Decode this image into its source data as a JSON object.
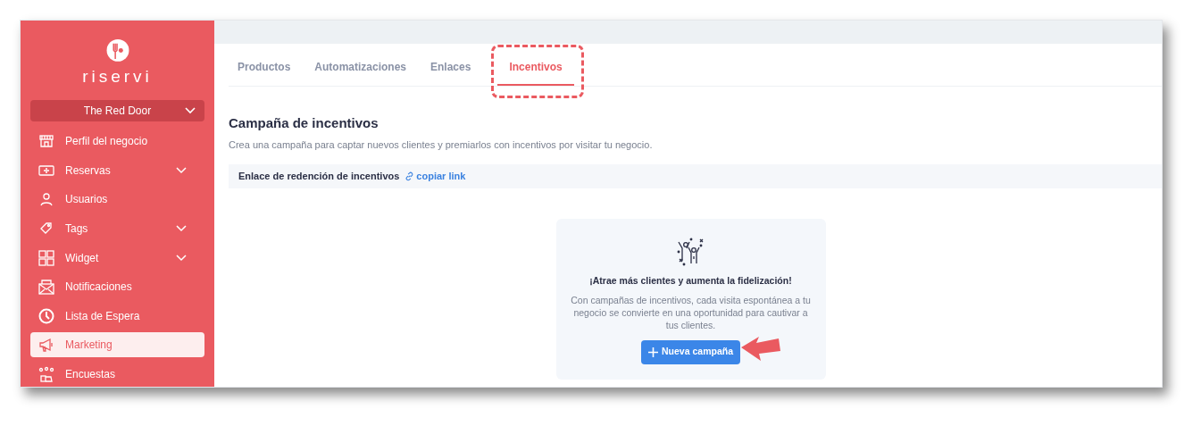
{
  "sidebar": {
    "brand": "riservi",
    "venue": "The Red Door",
    "items": [
      {
        "label": "Perfil del negocio",
        "expandable": false,
        "selected": false
      },
      {
        "label": "Reservas",
        "expandable": true,
        "selected": false
      },
      {
        "label": "Usuarios",
        "expandable": false,
        "selected": false
      },
      {
        "label": "Tags",
        "expandable": true,
        "selected": false
      },
      {
        "label": "Widget",
        "expandable": true,
        "selected": false
      },
      {
        "label": "Notificaciones",
        "expandable": false,
        "selected": false
      },
      {
        "label": "Lista de Espera",
        "expandable": false,
        "selected": false
      },
      {
        "label": "Marketing",
        "expandable": false,
        "selected": true
      },
      {
        "label": "Encuestas",
        "expandable": false,
        "selected": false
      }
    ]
  },
  "tabs": [
    {
      "label": "Productos",
      "selected": false
    },
    {
      "label": "Automatizaciones",
      "selected": false
    },
    {
      "label": "Enlaces",
      "selected": false
    },
    {
      "label": "Incentivos",
      "selected": true
    }
  ],
  "page": {
    "title": "Campaña de incentivos",
    "subtitle": "Crea una campaña para captar nuevos clientes y premiarlos con incentivos por visitar tu negocio.",
    "link_bar": {
      "label": "Enlace de redención de incentivos",
      "link": "copiar link"
    },
    "empty_state": {
      "heading": "¡Atrae más clientes y aumenta la fidelización!",
      "text": "Con campañas de incentivos, cada visita espontánea a tu negocio se convierte en una oportunidad para cautivar a tus clientes.",
      "button": "Nueva campaña"
    }
  }
}
